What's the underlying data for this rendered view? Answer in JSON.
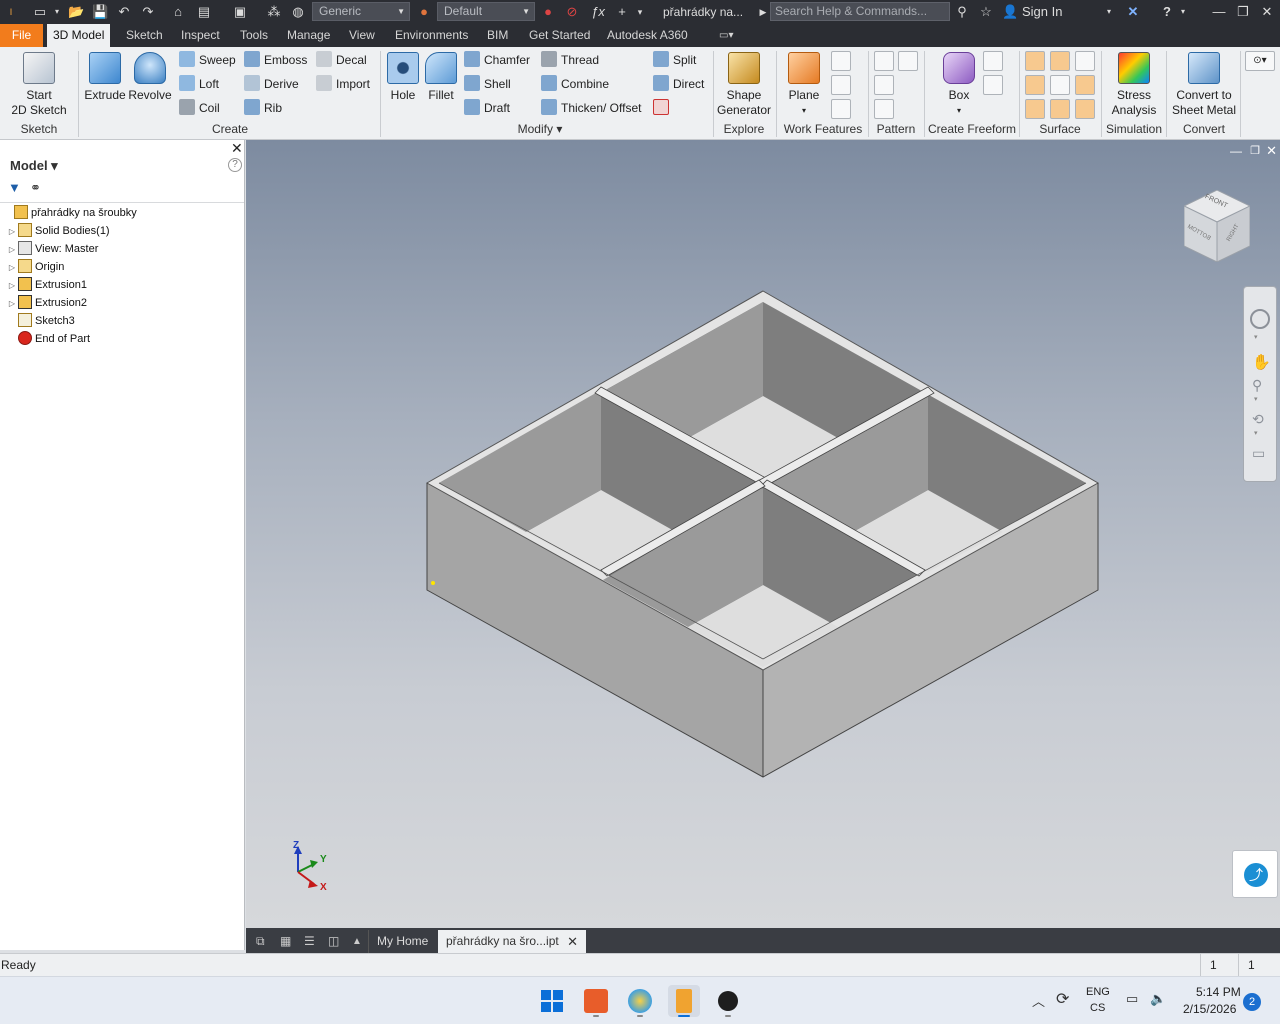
{
  "qat": {
    "material": "Generic",
    "appearance": "Default",
    "doc_title": "přahrádky na...",
    "search_placeholder": "Search Help & Commands...",
    "sign_in": "Sign In"
  },
  "tabs": [
    "File",
    "3D Model",
    "Sketch",
    "Inspect",
    "Tools",
    "Manage",
    "View",
    "Environments",
    "BIM",
    "Get Started",
    "Autodesk A360"
  ],
  "active_tab": "3D Model",
  "ribbon": {
    "sketch": {
      "start": "Start",
      "start2": "2D Sketch",
      "panel": "Sketch"
    },
    "create": {
      "extrude": "Extrude",
      "revolve": "Revolve",
      "sweep": "Sweep",
      "loft": "Loft",
      "coil": "Coil",
      "emboss": "Emboss",
      "derive": "Derive",
      "rib": "Rib",
      "decal": "Decal",
      "import": "Import",
      "panel": "Create"
    },
    "modify": {
      "hole": "Hole",
      "fillet": "Fillet",
      "chamfer": "Chamfer",
      "shell": "Shell",
      "draft": "Draft",
      "thread": "Thread",
      "combine": "Combine",
      "thicken": "Thicken/ Offset",
      "split": "Split",
      "direct": "Direct",
      "panel": "Modify ▾"
    },
    "explore": {
      "shape1": "Shape",
      "shape2": "Generator",
      "panel": "Explore"
    },
    "work": {
      "plane": "Plane",
      "panel": "Work Features"
    },
    "pattern": {
      "panel": "Pattern"
    },
    "freeform": {
      "box": "Box",
      "panel": "Create Freeform"
    },
    "surface": {
      "panel": "Surface"
    },
    "simulation": {
      "stress1": "Stress",
      "stress2": "Analysis",
      "panel": "Simulation"
    },
    "convert": {
      "c1": "Convert to",
      "c2": "Sheet Metal",
      "panel": "Convert"
    }
  },
  "browser": {
    "title": "Model ▾",
    "items": [
      {
        "label": "přahrádky na šroubky",
        "icon": "part-icon"
      },
      {
        "label": "Solid Bodies(1)",
        "icon": "folder-icon"
      },
      {
        "label": "View: Master",
        "icon": "view-icon"
      },
      {
        "label": "Origin",
        "icon": "folder-icon"
      },
      {
        "label": "Extrusion1",
        "icon": "extrusion-icon"
      },
      {
        "label": "Extrusion2",
        "icon": "extrusion-icon"
      },
      {
        "label": "Sketch3",
        "icon": "sketch-icon"
      },
      {
        "label": "End of Part",
        "icon": "end-of-part-icon"
      }
    ]
  },
  "viewcube": {
    "front": "FRONT",
    "right": "RIGHT",
    "bottom": "BOTTOM"
  },
  "axes": {
    "z": "Z",
    "y": "Y",
    "x": "X"
  },
  "doc_tabs": {
    "home": "My Home",
    "file": "přahrádky na šro...ipt"
  },
  "status": {
    "text": "Ready",
    "n1": "1",
    "n2": "1"
  },
  "taskbar": {
    "lang1": "ENG",
    "lang2": "CS",
    "time": "5:14 PM",
    "date": "2/15/2026",
    "badge": "2"
  },
  "colors": {
    "file_tab": "#f27c1c",
    "qat_bg": "#2b2d33",
    "ribbon_bg": "#eef0f2",
    "model_face": "#a9a9a9"
  }
}
